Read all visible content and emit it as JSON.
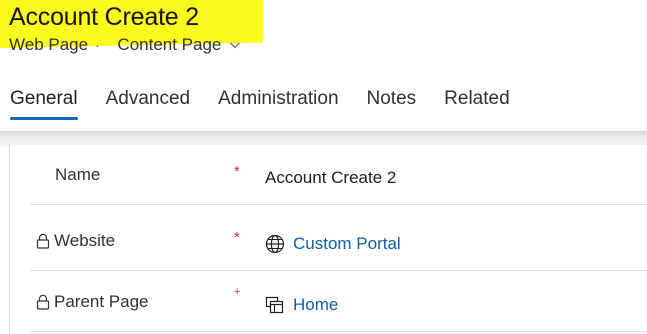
{
  "record": {
    "title": "Account Create 2",
    "entity": "Web Page",
    "separator": "·",
    "form": "Content Page"
  },
  "tabs": [
    {
      "label": "General",
      "active": true
    },
    {
      "label": "Advanced",
      "active": false
    },
    {
      "label": "Administration",
      "active": false
    },
    {
      "label": "Notes",
      "active": false
    },
    {
      "label": "Related",
      "active": false
    }
  ],
  "fields": {
    "name": {
      "label": "Name",
      "required": "*",
      "value": "Account Create 2"
    },
    "website": {
      "label": "Website",
      "required": "*",
      "value": "Custom Portal",
      "icon": "globe-icon"
    },
    "parent_page": {
      "label": "Parent Page",
      "required": "+",
      "value": "Home",
      "icon": "web-page-icon"
    }
  },
  "colors": {
    "highlight": "#fbfb1e",
    "accent": "#0f6cbd",
    "link": "#115ea3",
    "required": "#c4314b"
  }
}
